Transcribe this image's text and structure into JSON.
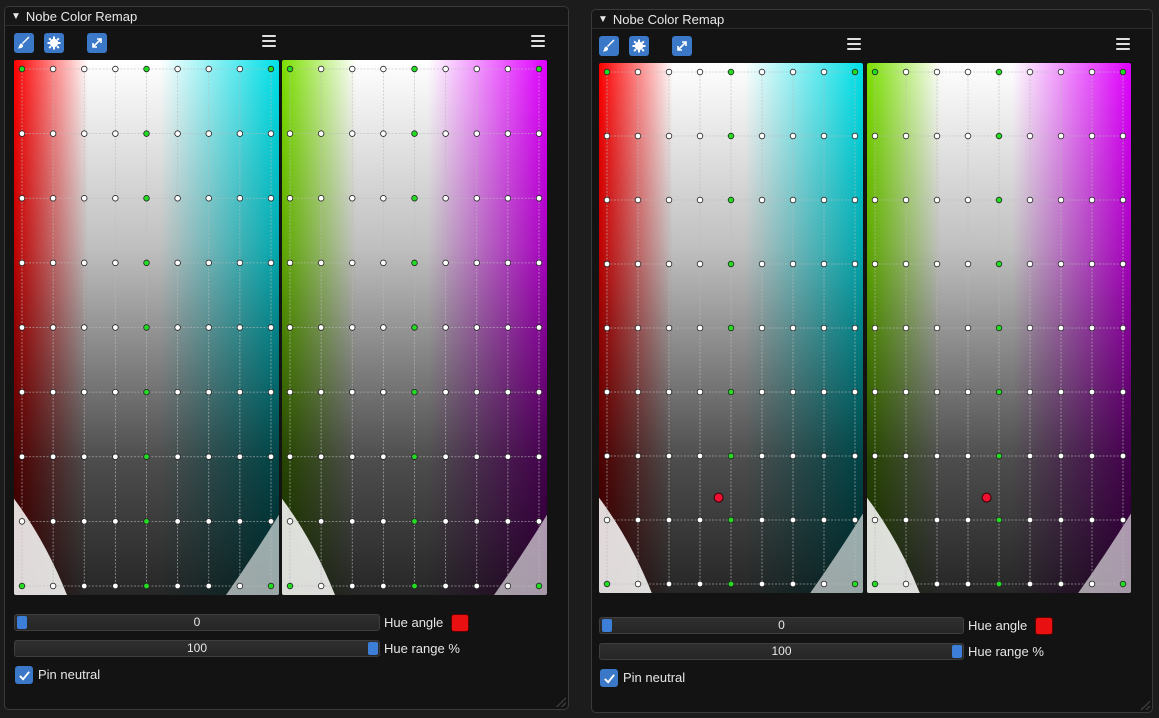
{
  "panels": [
    {
      "title": "Nobe Color Remap",
      "hue_angle": {
        "value": "0",
        "label": "Hue angle",
        "fraction": 0.0,
        "swatch_color": "#e81010"
      },
      "hue_range": {
        "value": "100",
        "label": "Hue range %",
        "fraction": 1.0
      },
      "pin_neutral": {
        "label": "Pin neutral",
        "checked": true
      },
      "selected_points": []
    },
    {
      "title": "Nobe Color Remap",
      "hue_angle": {
        "value": "0",
        "label": "Hue angle",
        "fraction": 0.0,
        "swatch_color": "#e81010"
      },
      "hue_range": {
        "value": "100",
        "label": "Hue range %",
        "fraction": 1.0
      },
      "pin_neutral": {
        "label": "Pin neutral",
        "checked": true
      },
      "selected_points": [
        {
          "plot": 0,
          "col": 3.6,
          "row": 6.65
        },
        {
          "plot": 1,
          "col": 3.6,
          "row": 6.65
        }
      ]
    }
  ],
  "toolbar_icons": [
    "brush-icon",
    "gear-icon",
    "expand-icon",
    "menu-icon"
  ],
  "colors": {
    "accent": "#3c78c8",
    "plot_left_hues": [
      "#ff0000",
      "#ffffff",
      "#00e0e8"
    ],
    "plot_right_hues": [
      "#7ce000",
      "#ffffff",
      "#e000ff"
    ],
    "node_white": "#ffffff",
    "node_green": "#22dd22",
    "selected_node": "#ee1133"
  },
  "grid": {
    "columns": 9,
    "rows": 9,
    "pinned_column": 4
  }
}
